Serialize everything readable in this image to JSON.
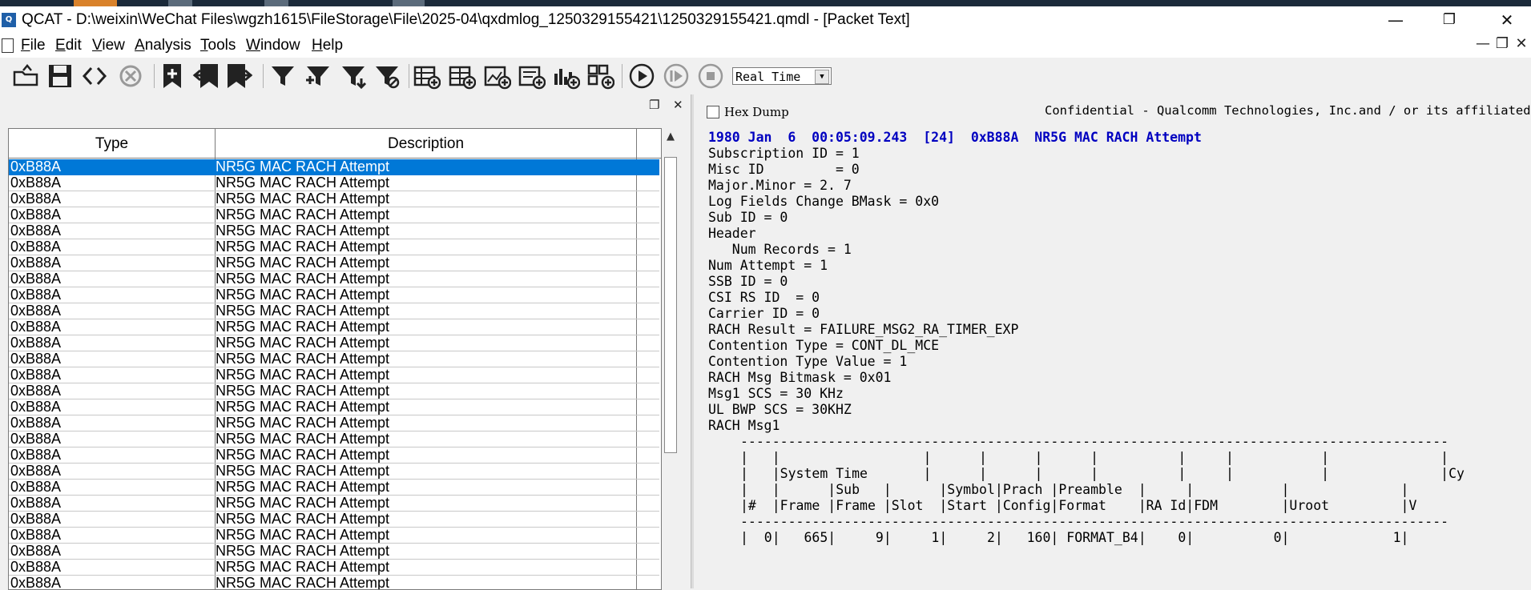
{
  "window": {
    "title": "QCAT - D:\\weixin\\WeChat Files\\wgzh1615\\FileStorage\\File\\2025-04\\qxdmlog_1250329155421\\1250329155421.qmdl - [Packet Text]",
    "app_icon_text": "Q",
    "minimize": "—",
    "restore": "❐",
    "close": "✕"
  },
  "menu": {
    "items": [
      {
        "ul": "F",
        "rest": "ile"
      },
      {
        "ul": "E",
        "rest": "dit"
      },
      {
        "ul": "V",
        "rest": "iew"
      },
      {
        "ul": "A",
        "rest": "nalysis"
      },
      {
        "ul": "T",
        "rest": "ools"
      },
      {
        "ul": "W",
        "rest": "indow"
      },
      {
        "ul": "H",
        "rest": "elp"
      }
    ],
    "mdi_min": "—",
    "mdi_restore": "❐",
    "mdi_close": "✕"
  },
  "toolbar": {
    "playback_mode": "Real Time",
    "icons": [
      "open-icon",
      "save-icon",
      "prev-next-icon",
      "reload-icon",
      "add-bookmark-icon",
      "bookmark-prev-icon",
      "bookmark-next-icon",
      "filter-icon",
      "filter-add-icon",
      "filter-down-icon",
      "filter-clear-icon",
      "view-table-icon",
      "view-add-icon",
      "view-chart-icon",
      "view-msg-icon",
      "view-bar-icon",
      "view-grid-icon",
      "play-icon",
      "step-icon",
      "stop-icon"
    ]
  },
  "grid": {
    "columns": [
      "Type",
      "Description"
    ],
    "rows": [
      [
        "0xB88A",
        "NR5G MAC RACH Attempt"
      ],
      [
        "0xB88A",
        "NR5G MAC RACH Attempt"
      ],
      [
        "0xB88A",
        "NR5G MAC RACH Attempt"
      ],
      [
        "0xB88A",
        "NR5G MAC RACH Attempt"
      ],
      [
        "0xB88A",
        "NR5G MAC RACH Attempt"
      ],
      [
        "0xB88A",
        "NR5G MAC RACH Attempt"
      ],
      [
        "0xB88A",
        "NR5G MAC RACH Attempt"
      ],
      [
        "0xB88A",
        "NR5G MAC RACH Attempt"
      ],
      [
        "0xB88A",
        "NR5G MAC RACH Attempt"
      ],
      [
        "0xB88A",
        "NR5G MAC RACH Attempt"
      ],
      [
        "0xB88A",
        "NR5G MAC RACH Attempt"
      ],
      [
        "0xB88A",
        "NR5G MAC RACH Attempt"
      ],
      [
        "0xB88A",
        "NR5G MAC RACH Attempt"
      ],
      [
        "0xB88A",
        "NR5G MAC RACH Attempt"
      ],
      [
        "0xB88A",
        "NR5G MAC RACH Attempt"
      ],
      [
        "0xB88A",
        "NR5G MAC RACH Attempt"
      ],
      [
        "0xB88A",
        "NR5G MAC RACH Attempt"
      ],
      [
        "0xB88A",
        "NR5G MAC RACH Attempt"
      ],
      [
        "0xB88A",
        "NR5G MAC RACH Attempt"
      ],
      [
        "0xB88A",
        "NR5G MAC RACH Attempt"
      ],
      [
        "0xB88A",
        "NR5G MAC RACH Attempt"
      ],
      [
        "0xB88A",
        "NR5G MAC RACH Attempt"
      ],
      [
        "0xB88A",
        "NR5G MAC RACH Attempt"
      ],
      [
        "0xB88A",
        "NR5G MAC RACH Attempt"
      ],
      [
        "0xB88A",
        "NR5G MAC RACH Attempt"
      ],
      [
        "0xB88A",
        "NR5G MAC RACH Attempt"
      ],
      [
        "0xB88A",
        "NR5G MAC RACH Attempt"
      ],
      [
        "0xB88A",
        "NR5G MAC RACH Attempt"
      ]
    ],
    "selected_index": 0
  },
  "packet": {
    "hex_dump_label": "Hex Dump",
    "confidential": "Confidential - Qualcomm Technologies, Inc.and / or its affiliated",
    "header_line": "1980 Jan  6  00:05:09.243  [24]  0xB88A  NR5G MAC RACH Attempt",
    "body": "Subscription ID = 1\nMisc ID         = 0\nMajor.Minor = 2. 7\nLog Fields Change BMask = 0x0\nSub ID = 0\nHeader\n   Num Records = 1\nNum Attempt = 1\nSSB ID = 0\nCSI RS ID  = 0\nCarrier ID = 0\nRACH Result = FAILURE_MSG2_RA_TIMER_EXP\nContention Type = CONT_DL_MCE\nContention Type Value = 1\nRACH Msg Bitmask = 0x01\nMsg1 SCS = 30 KHz\nUL BWP SCS = 30KHZ\nRACH Msg1",
    "table_text": "-----------------------------------------------------------------------------------------\n|   |                  |      |      |      |          |     |           |              |\n|   |System Time       |      |      |      |          |     |           |              |Cy\n|   |      |Sub   |      |Symbol|Prach |Preamble  |     |           |              |\n|#  |Frame |Frame |Slot  |Start |Config|Format    |RA Id|FDM        |Uroot         |V\n-----------------------------------------------------------------------------------------\n|  0|   665|     9|     1|     2|   160| FORMAT_B4|    0|          0|             1|"
  }
}
